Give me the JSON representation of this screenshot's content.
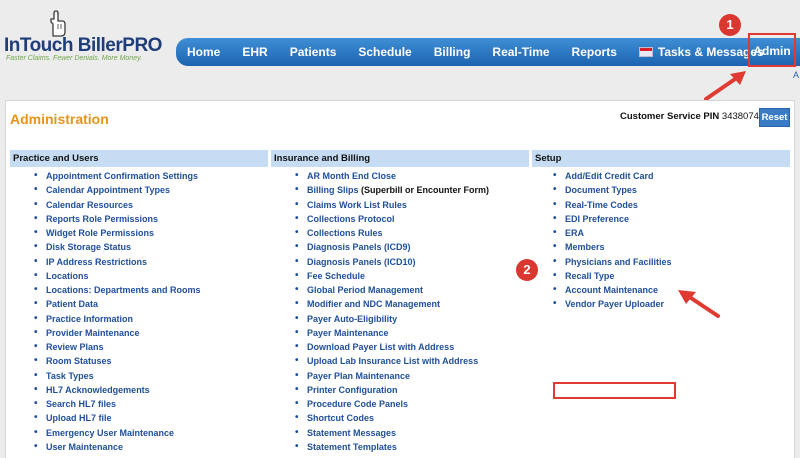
{
  "logo": {
    "title_main": "InTouch Biller",
    "title_suffix": "PRO",
    "tagline": "Faster Claims. Fewer Denials. More Money."
  },
  "nav": {
    "items": [
      "Home",
      "EHR",
      "Patients",
      "Schedule",
      "Billing",
      "Real-Time",
      "Reports",
      "Tasks & Messages"
    ],
    "admin": "Admin",
    "overflow_text": "A"
  },
  "page": {
    "title": "Administration",
    "pin_label": "Customer Service PIN",
    "pin_value": "3438074",
    "reset_button": "Reset"
  },
  "columns": [
    {
      "header": "Practice and Users",
      "items": [
        "Appointment Confirmation Settings",
        "Calendar Appointment Types",
        "Calendar Resources",
        "Reports Role Permissions",
        "Widget Role Permissions",
        "Disk Storage Status",
        "IP Address Restrictions",
        "Locations",
        "Locations: Departments and Rooms",
        "Patient Data",
        "Practice Information",
        "Provider Maintenance",
        "Review Plans",
        "Room Statuses",
        "Task Types",
        "HL7 Acknowledgements",
        "Search HL7 files",
        "Upload HL7 file",
        "Emergency User Maintenance",
        "User Maintenance"
      ]
    },
    {
      "header": "Insurance and Billing",
      "items": [
        "AR Month End Close",
        "Billing Slips",
        "Claims Work List Rules",
        "Collections Protocol",
        "Collections Rules",
        "Diagnosis Panels (ICD9)",
        "Diagnosis Panels (ICD10)",
        "Fee Schedule",
        "Global Period Management",
        "Modifier and NDC Management",
        "Payer Auto-Eligibility",
        "Payer Maintenance",
        "Download Payer List with Address",
        "Upload Lab Insurance List with Address",
        "Payer Plan Maintenance",
        "Printer Configuration",
        "Procedure Code Panels",
        "Shortcut Codes",
        "Statement Messages",
        "Statement Templates"
      ],
      "billing_slips_suffix": "(Superbill or Encounter Form)"
    },
    {
      "header": "Setup",
      "items": [
        "Add/Edit Credit Card",
        "Document Types",
        "Real-Time Codes",
        "EDI Preference",
        "ERA",
        "Members",
        "Physicians and Facilities",
        "Recall Type",
        "Account Maintenance",
        "Vendor Payer Uploader"
      ]
    }
  ],
  "annotations": {
    "step1": "1",
    "step2": "2",
    "color": "#e03a33"
  },
  "colors": {
    "nav_blue": "#1c63b0",
    "title_orange": "#e8941a",
    "link_blue": "#1f4f9a",
    "header_bg": "#c6dcf2"
  }
}
